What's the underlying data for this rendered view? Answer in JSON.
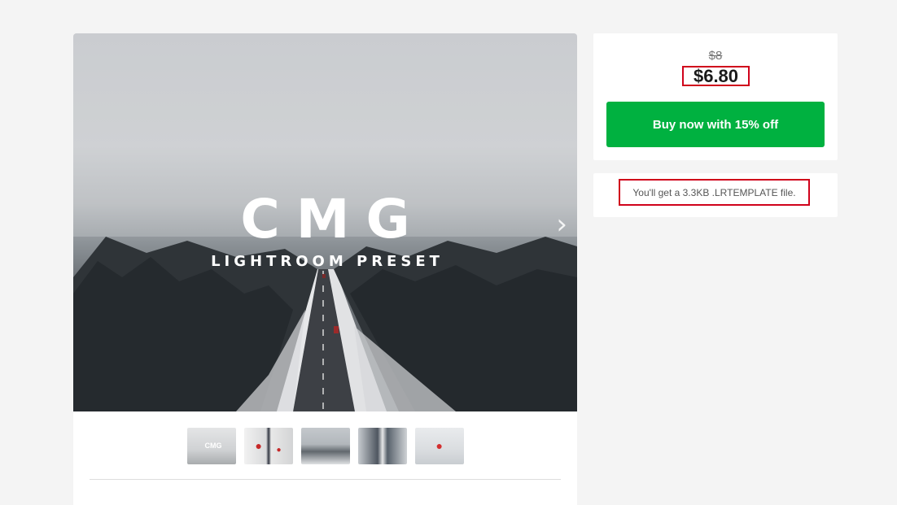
{
  "product": {
    "hero": {
      "title": "CMG",
      "subtitle": "LIGHTROOM PRESET",
      "next_icon": "chevron-right-icon"
    },
    "thumbnails": [
      {
        "label": "Preview 1"
      },
      {
        "label": "Preview 2"
      },
      {
        "label": "Preview 3"
      },
      {
        "label": "Preview 4"
      },
      {
        "label": "Preview 5"
      }
    ]
  },
  "pricing": {
    "old_price": "$8",
    "current_price": "$6.80",
    "buy_label": "Buy now with 15% off",
    "buy_color": "#00b140",
    "highlight_color": "#d0021b"
  },
  "file": {
    "info": "You'll get a 3.3KB .LRTEMPLATE file."
  }
}
